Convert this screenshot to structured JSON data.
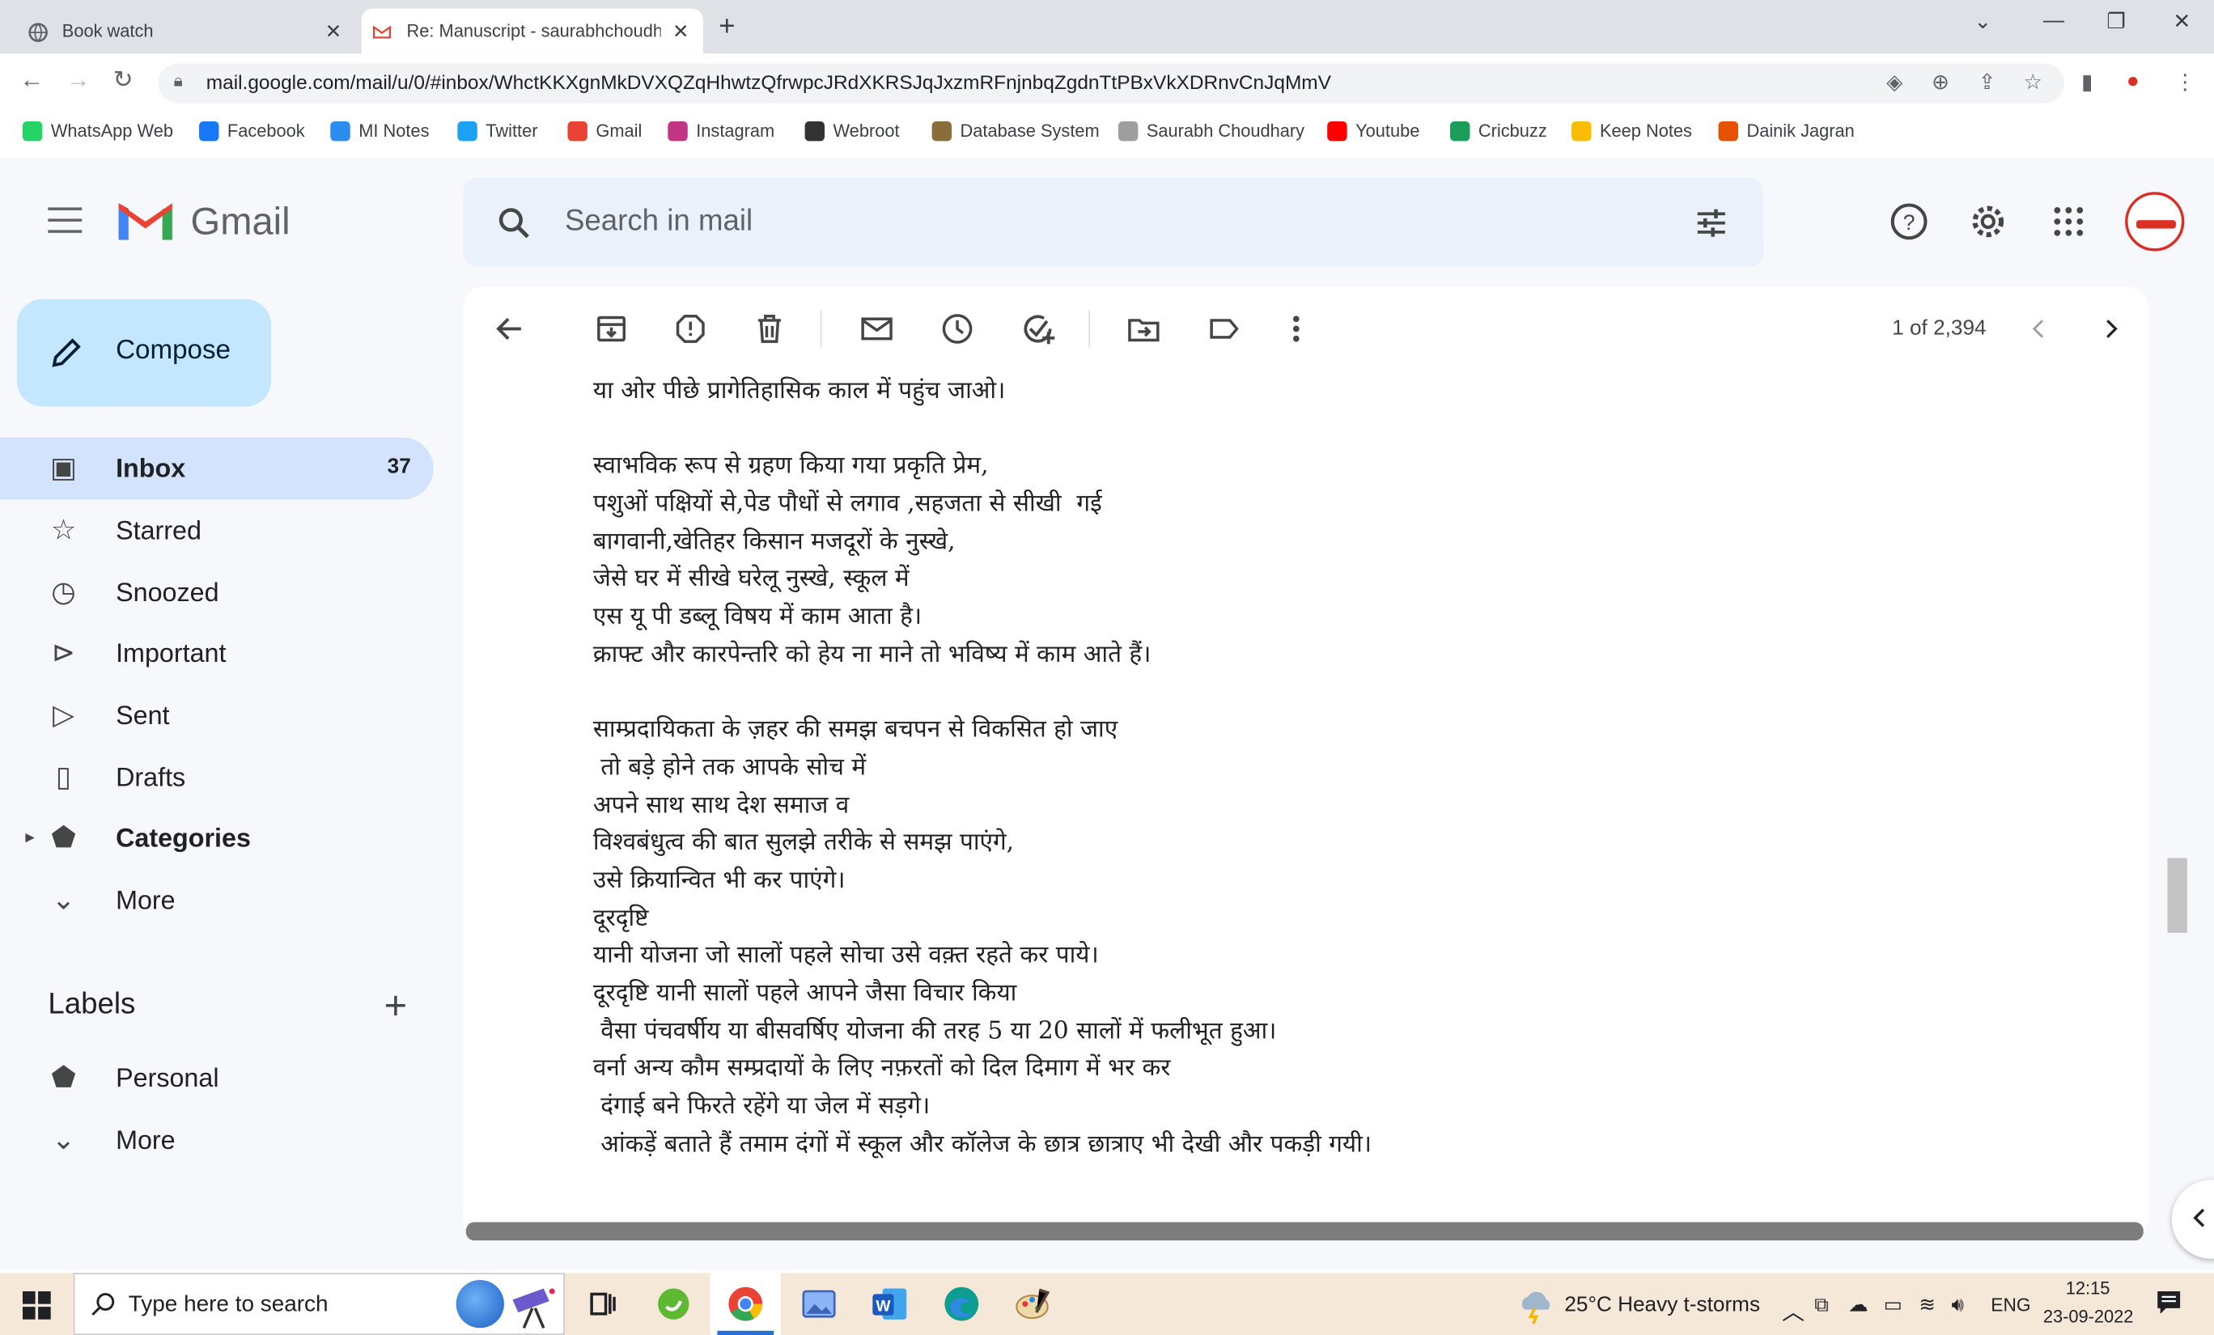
{
  "browser": {
    "tabs": [
      {
        "title": "Book watch",
        "active": false
      },
      {
        "title": "Re: Manuscript - saurabhchoudh",
        "active": true
      }
    ],
    "url": "mail.google.com/mail/u/0/#inbox/WhctKKXgnMkDVXQZqHhwtzQfrwpcJRdXKRSJqJxzmRFnjnbqZgdnTtPBxVkXDRnvCnJqMmV",
    "bookmarks": [
      {
        "label": "WhatsApp Web",
        "color": "#25d366"
      },
      {
        "label": "Facebook",
        "color": "#1877f2"
      },
      {
        "label": "MI Notes",
        "color": "#2d8cf0"
      },
      {
        "label": "Twitter",
        "color": "#1da1f2"
      },
      {
        "label": "Gmail",
        "color": "#ea4335"
      },
      {
        "label": "Instagram",
        "color": "#c13584"
      },
      {
        "label": "Webroot",
        "color": "#333333"
      },
      {
        "label": "Database System",
        "color": "#8a6d3b"
      },
      {
        "label": "Saurabh Choudhary",
        "color": "#9e9e9e"
      },
      {
        "label": "Youtube",
        "color": "#ff0000"
      },
      {
        "label": "Cricbuzz",
        "color": "#1b9e5a"
      },
      {
        "label": "Keep Notes",
        "color": "#fbbc04"
      },
      {
        "label": "Dainik Jagran",
        "color": "#e65100"
      }
    ]
  },
  "gmail": {
    "brand": "Gmail",
    "search_placeholder": "Search in mail",
    "compose_label": "Compose",
    "nav": [
      {
        "label": "Inbox",
        "count": "37",
        "icon": "inbox-icon",
        "selected": true
      },
      {
        "label": "Starred",
        "count": "",
        "icon": "star-icon"
      },
      {
        "label": "Snoozed",
        "count": "",
        "icon": "clock-icon"
      },
      {
        "label": "Important",
        "count": "",
        "icon": "important-icon"
      },
      {
        "label": "Sent",
        "count": "",
        "icon": "send-icon"
      },
      {
        "label": "Drafts",
        "count": "",
        "icon": "draft-icon"
      },
      {
        "label": "Categories",
        "count": "",
        "icon": "label-icon",
        "bold": true
      },
      {
        "label": "More",
        "count": "",
        "icon": "chevron-down-icon"
      }
    ],
    "labels_heading": "Labels",
    "labels": [
      {
        "label": "Personal",
        "icon": "label-icon"
      },
      {
        "label": "More",
        "icon": "chevron-down-icon"
      }
    ],
    "pager": "1 of 2,394",
    "accent": "#c2e7ff"
  },
  "message": {
    "lines": [
      "या ओर पीछे प्रागेतिहासिक काल में पहुंच जाओ।",
      "",
      "स्वाभविक रूप से ग्रहण किया गया प्रकृति प्रेम,",
      "पशुओं पक्षियों से,पेड पौधों से लगाव ,सहजता से सीखी  गई",
      "बागवानी,खेतिहर किसान मजदूरों के नुस्खे,",
      "जेसे घर में सीखे घरेलू नुस्खे, स्कूल में",
      "एस यू पी डब्लू विषय में काम आता है।",
      "क्राफ्ट और कारपेन्तरि को हेय ना माने तो भविष्य में काम आते हैं।",
      "",
      "साम्प्रदायिकता के ज़हर की समझ बचपन से विकसित हो जाए",
      " तो बड़े होने तक आपके सोच में",
      "अपने साथ साथ देश समाज व",
      "विश्वबंधुत्व की बात सुलझे तरीके से समझ पाएंगे,",
      "उसे क्रियान्वित भी कर पाएंगे।",
      "दूरदृष्टि",
      "यानी योजना जो सालों पहले सोचा उसे वक़्त रहते कर पाये।",
      "दूरदृष्टि यानी सालों पहले आपने जैसा विचार किया",
      " वैसा पंचवर्षीय या बीसवर्षिए योजना की तरह 5 या 20 सालों में फलीभूत हुआ।",
      "वर्ना अन्य कौम सम्प्रदायों के लिए नफ़रतों को दिल दिमाग में भर कर",
      " दंगाई बने फिरते रहेंगे या जेल में सड़गे।",
      " आंकड़ें बताते हैं तमाम दंगों में स्कूल और कॉलेज के छात्र छात्राए भी देखी और पकड़ी गयी।"
    ]
  },
  "taskbar": {
    "search_placeholder": "Type here to search",
    "weather": "25°C  Heavy t-storms",
    "lang": "ENG",
    "time": "12:15",
    "date": "23-09-2022"
  }
}
